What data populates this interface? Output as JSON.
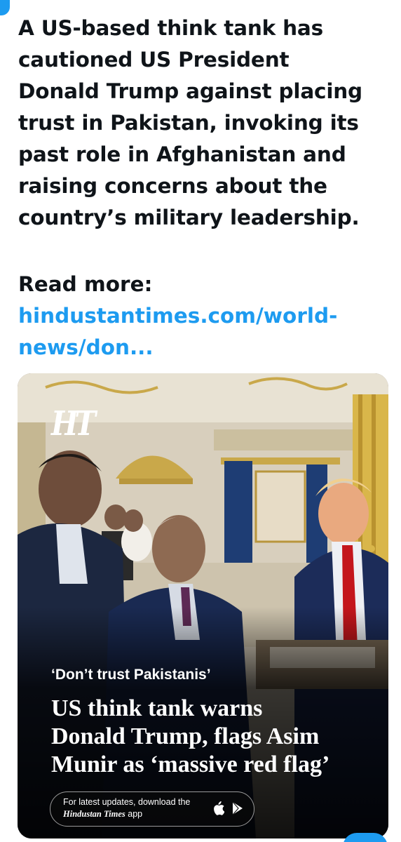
{
  "tweet": {
    "lines": [
      "A US-based think tank has",
      "cautioned US President",
      "Donald Trump against placing",
      "trust in Pakistan, invoking its",
      "past role in Afghanistan and",
      "raising concerns about the",
      "country’s military leadership."
    ],
    "read_more_label": "Read more:",
    "link_line1": "hindustantimes.com/world-",
    "link_line2": "news/don..."
  },
  "card": {
    "logo": "HT",
    "kicker": "‘Don’t trust Pakistanis’",
    "headline_lines": [
      "US think tank warns",
      "Donald Trump, flags Asim",
      "Munir as ‘massive red flag’"
    ],
    "promo_line1": "For latest updates, download the",
    "promo_brand": "Hindustan Times",
    "promo_suffix": " app",
    "icons": [
      "apple-icon",
      "play-store-icon"
    ]
  },
  "colors": {
    "link": "#1d9bf0",
    "accent": "#1d9bf0",
    "text": "#0f1419"
  }
}
